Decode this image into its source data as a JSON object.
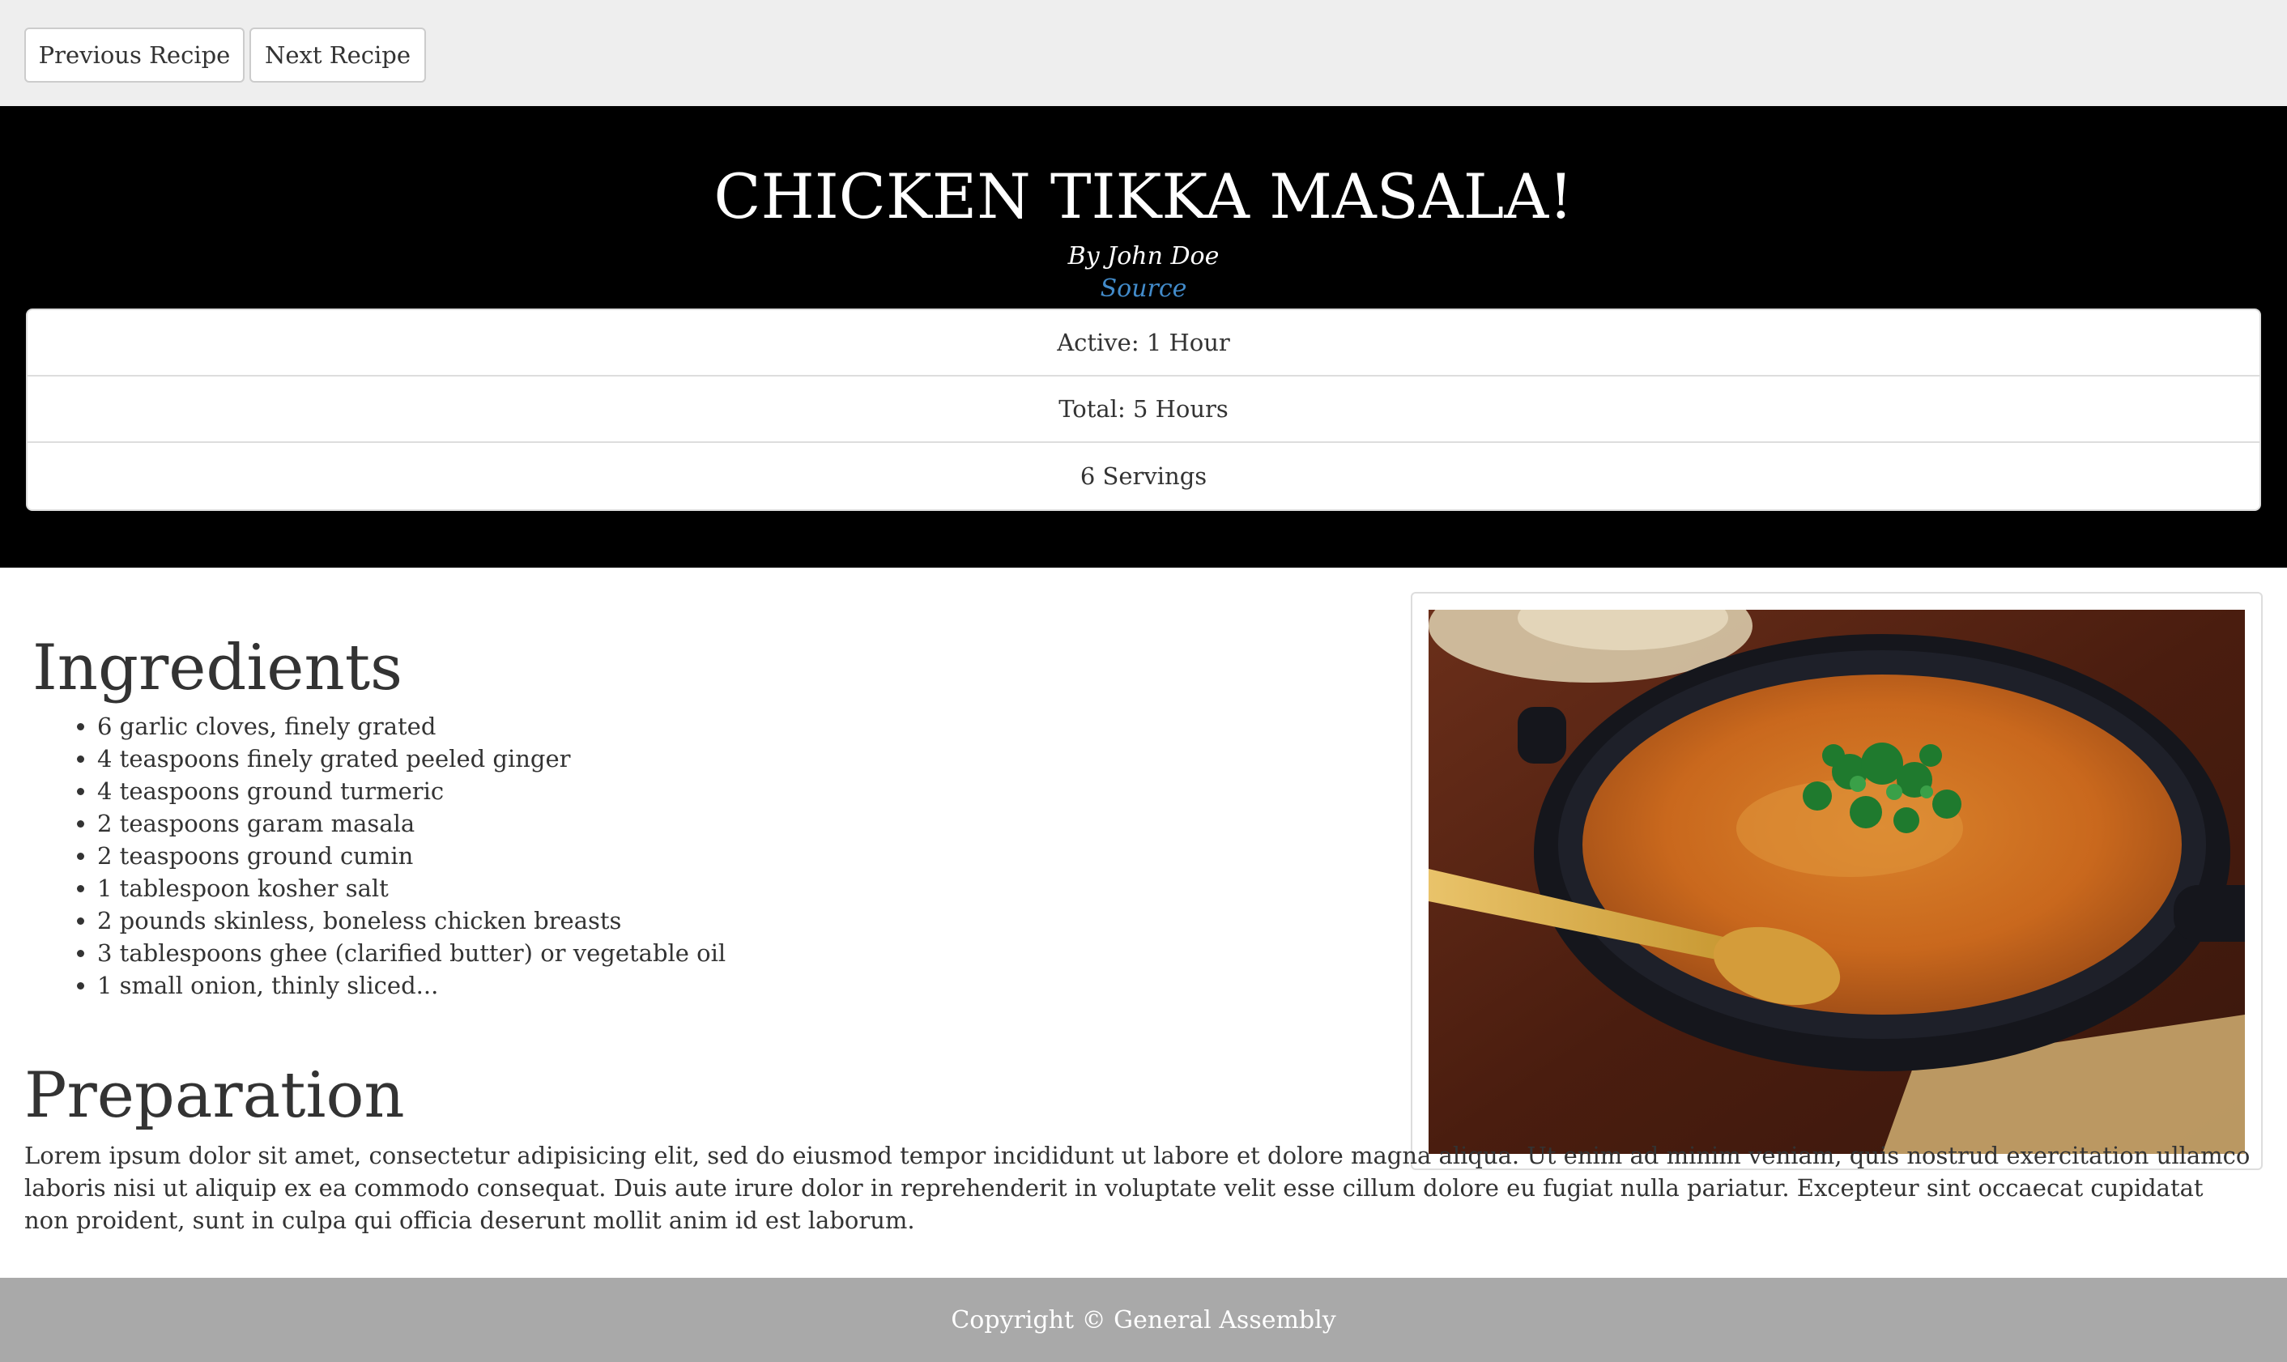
{
  "nav": {
    "prev_label": "Previous Recipe",
    "next_label": "Next Recipe"
  },
  "recipe": {
    "title": "CHICKEN TIKKA MASALA!",
    "author": "By John Doe",
    "source_label": "Source",
    "info": [
      "Active: 1 Hour",
      "Total: 5 Hours",
      "6 Servings"
    ]
  },
  "ingredients": {
    "heading": "Ingredients",
    "items": [
      "6 garlic cloves, finely grated",
      "4 teaspoons finely grated peeled ginger",
      "4 teaspoons ground turmeric",
      "2 teaspoons garam masala",
      "2 teaspoons ground cumin",
      "1 tablespoon kosher salt",
      "2 pounds skinless, boneless chicken breasts",
      "3 tablespoons ghee (clarified butter) or vegetable oil",
      "1 small onion, thinly sliced..."
    ]
  },
  "preparation": {
    "heading": "Preparation",
    "text": "Lorem ipsum dolor sit amet, consectetur adipisicing elit, sed do eiusmod tempor incididunt ut labore et dolore magna aliqua. Ut enim ad minim veniam, quis nostrud exercitation ullamco laboris nisi ut aliquip ex ea commodo consequat. Duis aute irure dolor in reprehenderit in voluptate velit esse cillum dolore eu fugiat nulla pariatur. Excepteur sint occaecat cupidatat non proident, sunt in culpa qui officia deserunt mollit anim id est laborum."
  },
  "footer": {
    "text": "Copyright © General Assembly"
  },
  "colors": {
    "hero_bg": "#000000",
    "topbar_bg": "#eeeeee",
    "footer_bg": "#a9a9a9",
    "link": "#428bca"
  }
}
